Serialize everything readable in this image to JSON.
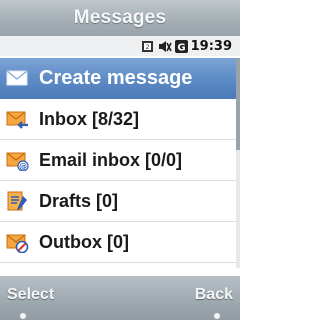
{
  "header": {
    "title": "Messages"
  },
  "status": {
    "time": "19:39",
    "icons": [
      "sim-card-icon",
      "silent-mode-icon",
      "g-network-icon"
    ]
  },
  "menu": {
    "items": [
      {
        "label": "Create message",
        "icon": "envelope-icon",
        "selected": true
      },
      {
        "label": "Inbox [8/32]",
        "icon": "inbox-icon"
      },
      {
        "label": "Email inbox [0/0]",
        "icon": "email-inbox-icon"
      },
      {
        "label": "Drafts [0]",
        "icon": "drafts-icon"
      },
      {
        "label": "Outbox [0]",
        "icon": "outbox-icon"
      }
    ]
  },
  "softkeys": {
    "left": "Select",
    "right": "Back"
  },
  "colors": {
    "selection": "#5e8cc6",
    "envelope_orange": "#e8891c",
    "arrow_blue": "#2f5fb5"
  }
}
